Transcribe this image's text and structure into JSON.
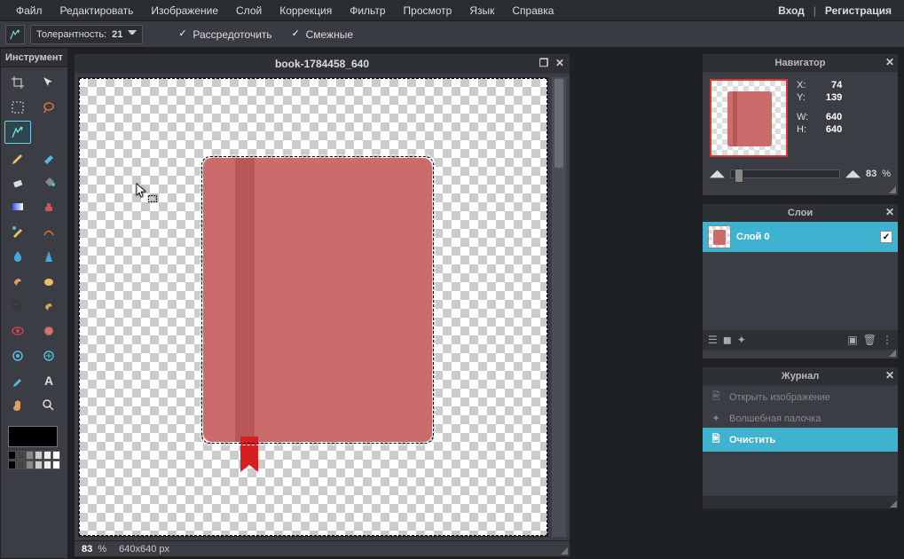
{
  "menu": [
    "Файл",
    "Редактировать",
    "Изображение",
    "Слой",
    "Коррекция",
    "Фильтр",
    "Просмотр",
    "Язык",
    "Справка"
  ],
  "auth": {
    "login": "Вход",
    "register": "Регистрация"
  },
  "options": {
    "tolerance_label": "Толерантность:",
    "tolerance_value": "21",
    "antialias": "Рассредоточить",
    "contiguous": "Смежные"
  },
  "toolbox_title": "Инструмент",
  "document": {
    "title": "book-1784458_640",
    "zoom": "83",
    "zoom_unit": "%",
    "dimensions": "640x640 px"
  },
  "navigator": {
    "title": "Навигатор",
    "x_label": "X:",
    "x": "74",
    "y_label": "Y:",
    "y": "139",
    "w_label": "W:",
    "w": "640",
    "h_label": "H:",
    "h": "640",
    "zoom": "83",
    "zoom_unit": "%"
  },
  "layers": {
    "title": "Слои",
    "layer0": "Слой 0"
  },
  "history": {
    "title": "Журнал",
    "items": [
      {
        "label": "Открыть изображение",
        "active": false,
        "icon": "open"
      },
      {
        "label": "Волшебная палочка",
        "active": false,
        "icon": "wand"
      },
      {
        "label": "Очистить",
        "active": true,
        "icon": "clear"
      }
    ]
  },
  "palette": [
    "#000",
    "#444",
    "#888",
    "#ccc",
    "#eee",
    "#fff",
    "#000",
    "#444",
    "#888",
    "#ccc",
    "#eee",
    "#fff"
  ]
}
